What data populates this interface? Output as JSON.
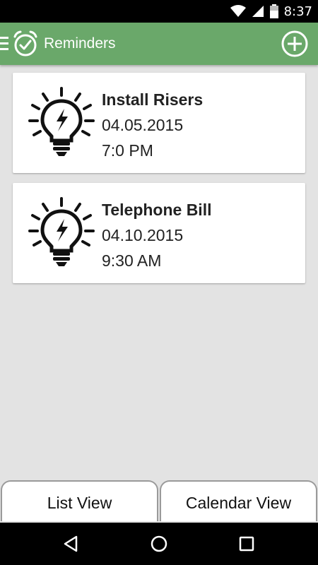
{
  "status_bar": {
    "time": "8:37",
    "icons": [
      "wifi-icon",
      "signal-icon",
      "battery-icon"
    ]
  },
  "app_bar": {
    "title": "Reminders",
    "icons": [
      "menu-icon",
      "alarm-clock-icon",
      "add-circle-icon"
    ],
    "color": "#6aa86a"
  },
  "reminders": [
    {
      "title": "Install Risers",
      "date": "04.05.2015",
      "time": "7:0 PM",
      "icon": "lightbulb-icon"
    },
    {
      "title": "Telephone Bill",
      "date": "04.10.2015",
      "time": "9:30 AM",
      "icon": "lightbulb-icon"
    }
  ],
  "tabs": {
    "list_view": "List View",
    "calendar_view": "Calendar View"
  },
  "nav_bar": {
    "icons": [
      "back-icon",
      "home-icon",
      "recents-icon"
    ]
  }
}
